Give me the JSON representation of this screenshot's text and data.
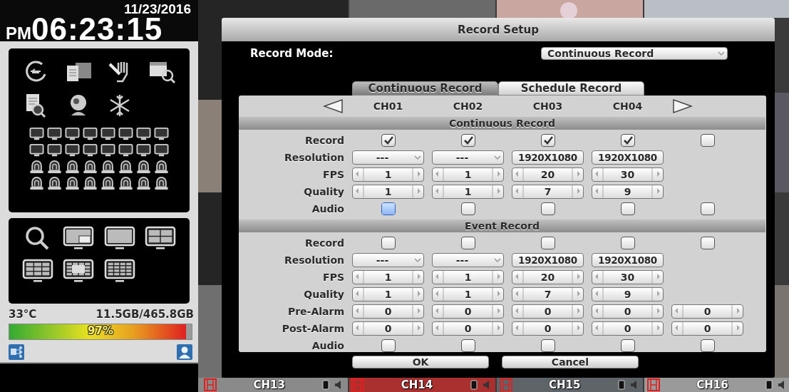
{
  "clock": {
    "date": "11/23/2016",
    "meridiem": "PM",
    "time": "06:23:15"
  },
  "status": {
    "temperature": "33°C",
    "disk_usage": "11.5GB/465.8GB",
    "disk_bar": {
      "level": 0.97,
      "reading": "97%"
    }
  },
  "channel_bar": [
    {
      "label": "CH13"
    },
    {
      "label": "CH14"
    },
    {
      "label": "CH15"
    },
    {
      "label": "CH16"
    }
  ],
  "dialog": {
    "title": "Record Setup",
    "record_mode": {
      "label": "Record Mode:",
      "value": "Continuous Record"
    },
    "tabs": [
      {
        "label": "Continuous Record",
        "selected": true
      },
      {
        "label": "Schedule Record",
        "selected": false
      }
    ],
    "channels": [
      "CH01",
      "CH02",
      "CH03",
      "CH04"
    ],
    "sections": [
      {
        "title": "Continuous Record",
        "rows": [
          {
            "label": "Record",
            "kind": "checkbox",
            "cells": [
              {
                "checked": true,
                "focused": false
              },
              {
                "checked": true,
                "focused": false
              },
              {
                "checked": true,
                "focused": false
              },
              {
                "checked": true,
                "focused": false
              },
              {
                "checked": false,
                "focused": false
              }
            ]
          },
          {
            "label": "Resolution",
            "kind": "dropdown",
            "cells": [
              {
                "value": "---",
                "arrow": true
              },
              {
                "value": "---",
                "arrow": true
              },
              {
                "value": "1920X1080",
                "arrow": false
              },
              {
                "value": "1920X1080",
                "arrow": false
              }
            ]
          },
          {
            "label": "FPS",
            "kind": "spinner",
            "cells": [
              {
                "value": "1"
              },
              {
                "value": "1"
              },
              {
                "value": "20"
              },
              {
                "value": "30"
              }
            ]
          },
          {
            "label": "Quality",
            "kind": "spinner",
            "cells": [
              {
                "value": "1"
              },
              {
                "value": "1"
              },
              {
                "value": "7"
              },
              {
                "value": "9"
              }
            ]
          },
          {
            "label": "Audio",
            "kind": "checkbox",
            "cells": [
              {
                "checked": false,
                "focused": true
              },
              {
                "checked": false,
                "focused": false
              },
              {
                "checked": false,
                "focused": false
              },
              {
                "checked": false,
                "focused": false
              },
              {
                "checked": false,
                "focused": false
              }
            ]
          }
        ]
      },
      {
        "title": "Event Record",
        "rows": [
          {
            "label": "Record",
            "kind": "checkbox",
            "cells": [
              {
                "checked": false,
                "focused": false
              },
              {
                "checked": false,
                "focused": false
              },
              {
                "checked": false,
                "focused": false
              },
              {
                "checked": false,
                "focused": false
              },
              {
                "checked": false,
                "focused": false
              }
            ]
          },
          {
            "label": "Resolution",
            "kind": "dropdown",
            "cells": [
              {
                "value": "---",
                "arrow": true
              },
              {
                "value": "---",
                "arrow": true
              },
              {
                "value": "1920X1080",
                "arrow": false
              },
              {
                "value": "1920X1080",
                "arrow": false
              }
            ]
          },
          {
            "label": "FPS",
            "kind": "spinner",
            "cells": [
              {
                "value": "1"
              },
              {
                "value": "1"
              },
              {
                "value": "20"
              },
              {
                "value": "30"
              }
            ]
          },
          {
            "label": "Quality",
            "kind": "spinner",
            "cells": [
              {
                "value": "1"
              },
              {
                "value": "1"
              },
              {
                "value": "7"
              },
              {
                "value": "9"
              }
            ]
          },
          {
            "label": "Pre-Alarm",
            "kind": "spinner",
            "cells": [
              {
                "value": "0"
              },
              {
                "value": "0"
              },
              {
                "value": "0"
              },
              {
                "value": "0"
              },
              {
                "value": "0"
              }
            ]
          },
          {
            "label": "Post-Alarm",
            "kind": "spinner",
            "cells": [
              {
                "value": "0"
              },
              {
                "value": "0"
              },
              {
                "value": "0"
              },
              {
                "value": "0"
              },
              {
                "value": "0"
              }
            ]
          },
          {
            "label": "Audio",
            "kind": "checkbox",
            "cells": [
              {
                "checked": false,
                "focused": false
              },
              {
                "checked": false,
                "focused": false
              },
              {
                "checked": false,
                "focused": false
              },
              {
                "checked": false,
                "focused": false
              },
              {
                "checked": false,
                "focused": false
              }
            ]
          }
        ]
      }
    ],
    "buttons": [
      "OK",
      "Cancel"
    ]
  }
}
